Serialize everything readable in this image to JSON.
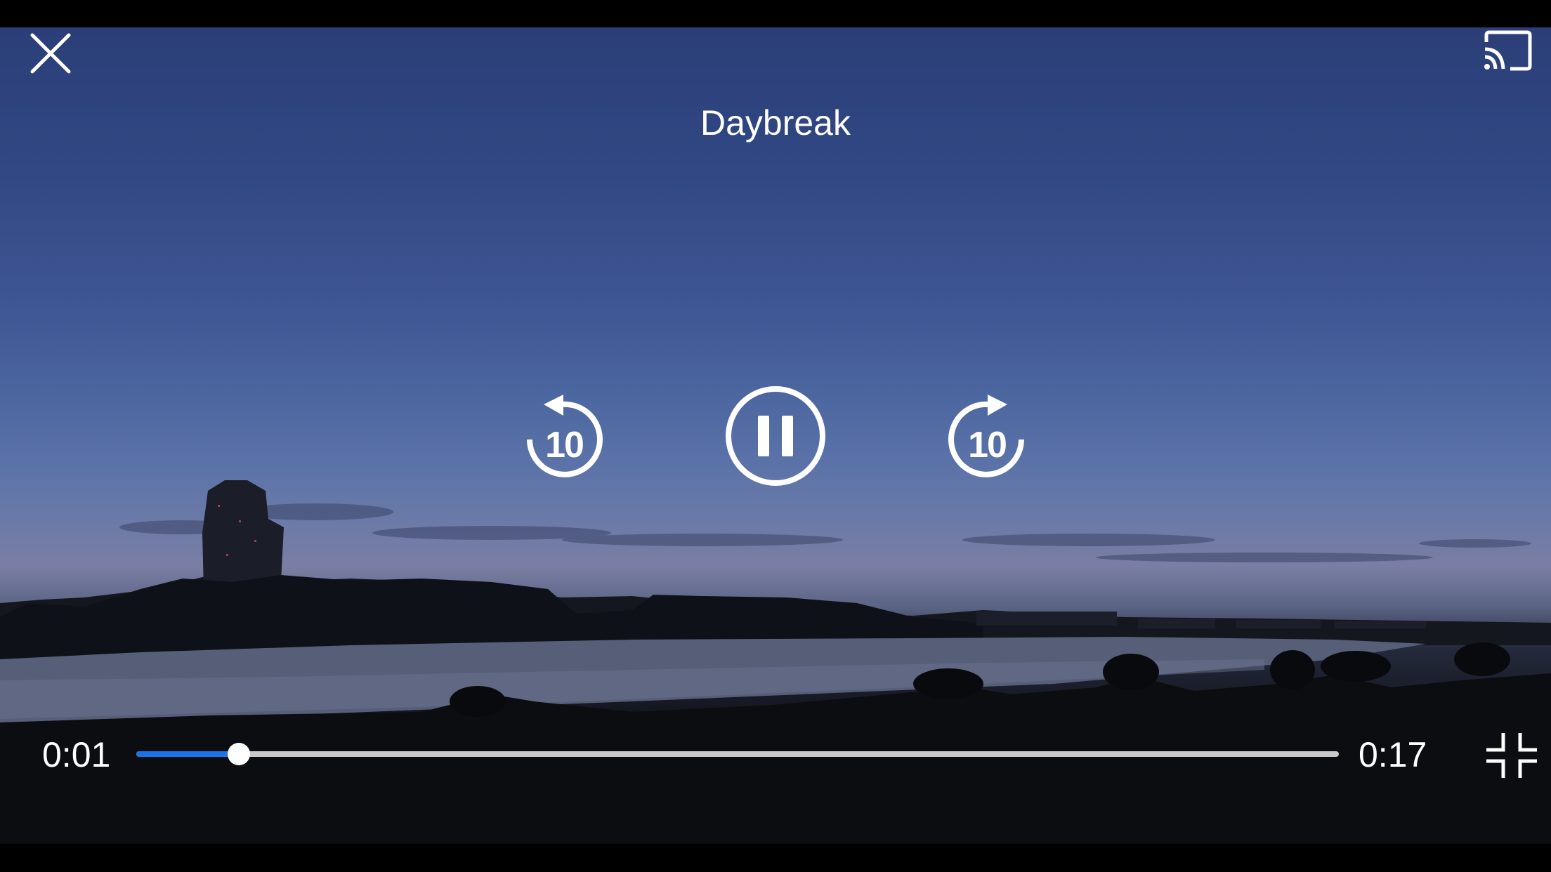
{
  "player": {
    "title": "Daybreak",
    "current_time": "0:01",
    "total_time": "0:17",
    "progress": 0.085,
    "rewind_seconds": "10",
    "forward_seconds": "10",
    "state": "playing"
  },
  "icons": {
    "close": "close-icon",
    "cast": "cast-icon",
    "rewind": "replay-10-icon",
    "pause": "pause-icon",
    "forward": "forward-10-icon",
    "exit_fullscreen": "exit-fullscreen-icon"
  },
  "colors": {
    "accent": "#1a73e8",
    "track": "#c9c9c9",
    "controls": "#ffffff"
  }
}
